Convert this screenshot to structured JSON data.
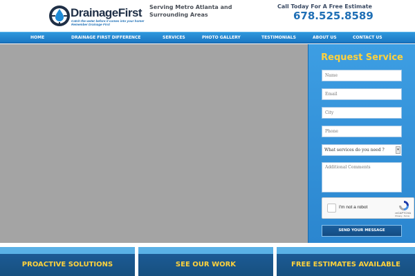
{
  "header": {
    "logo_name": "DrainageFirst",
    "logo_tagline_1": "Catch the water before it comes into your home!",
    "logo_tagline_2": "Remember Drainage First",
    "serving": "Serving Metro Atlanta and Surrounding Areas",
    "call_label": "Call Today For A Free Estimate",
    "phone": "678.525.8589"
  },
  "nav": {
    "items": [
      {
        "label": "HOME"
      },
      {
        "label": "DRAINAGE FIRST DIFFERENCE"
      },
      {
        "label": "SERVICES"
      },
      {
        "label": "PHOTO GALLERY"
      },
      {
        "label": "TESTIMONIALS"
      },
      {
        "label": "ABOUT US"
      },
      {
        "label": "CONTACT US"
      }
    ]
  },
  "form": {
    "title": "Request Service",
    "name_placeholder": "Name",
    "email_placeholder": "Email",
    "city_placeholder": "City",
    "phone_placeholder": "Phone",
    "service_selected": "What services do you need ?",
    "comments_placeholder": "Additional Comments",
    "recaptcha_label": "I'm not a robot",
    "recaptcha_brand": "reCAPTCHA",
    "recaptcha_links": "Privacy - Terms",
    "submit_label": "SEND YOUR MESSAGE"
  },
  "cards": [
    {
      "title": "PROACTIVE SOLUTIONS"
    },
    {
      "title": "SEE OUR WORK"
    },
    {
      "title": "FREE ESTIMATES AVAILABLE"
    }
  ],
  "colors": {
    "brand_blue": "#1f6fb5",
    "nav_blue": "#2485cf",
    "accent_yellow": "#ffd23c",
    "hero_gray": "#a4a4a4"
  }
}
